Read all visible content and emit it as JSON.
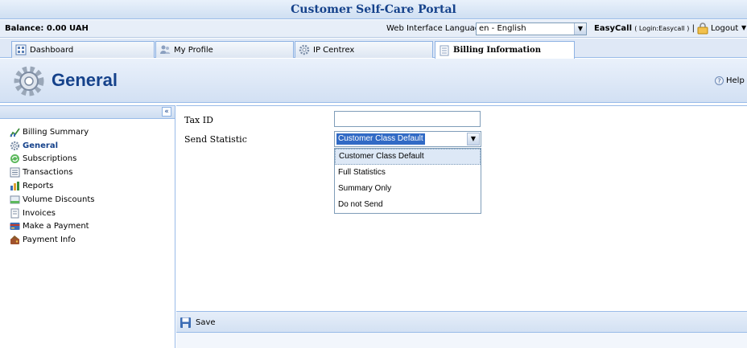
{
  "app": {
    "title": "Customer Self-Care Portal"
  },
  "infobar": {
    "balance": "Balance: 0.00 UAH",
    "language_label": "Web Interface Language:",
    "language_value": "en - English",
    "account_name": "EasyCall",
    "account_login": "( Login:Easycall )",
    "separator": "|",
    "logout": "Logout"
  },
  "tabs": [
    {
      "label": "Dashboard",
      "icon": "dashboard-icon"
    },
    {
      "label": "My Profile",
      "icon": "users-icon"
    },
    {
      "label": "IP Centrex",
      "icon": "gear-icon"
    },
    {
      "label": "Billing Information",
      "icon": "document-icon",
      "active": true
    }
  ],
  "header": {
    "title": "General",
    "help": "Help"
  },
  "sidebar": {
    "collapse": "«",
    "items": [
      {
        "label": "Billing Summary",
        "icon": "chart-icon"
      },
      {
        "label": "General",
        "icon": "gear-icon",
        "active": true
      },
      {
        "label": "Subscriptions",
        "icon": "refresh-icon"
      },
      {
        "label": "Transactions",
        "icon": "list-icon"
      },
      {
        "label": "Reports",
        "icon": "bar-chart-icon"
      },
      {
        "label": "Volume Discounts",
        "icon": "discount-icon"
      },
      {
        "label": "Invoices",
        "icon": "invoice-icon"
      },
      {
        "label": "Make a Payment",
        "icon": "credit-card-icon"
      },
      {
        "label": "Payment Info",
        "icon": "wallet-icon"
      }
    ]
  },
  "form": {
    "tax_id_label": "Tax ID",
    "tax_id_value": "",
    "send_statistic_label": "Send Statistic",
    "send_statistic_value": "Customer Class Default",
    "options": [
      "Customer Class Default",
      "Full Statistics",
      "Summary Only",
      "Do not Send"
    ]
  },
  "footer": {
    "save": "Save"
  },
  "colors": {
    "accent": "#15428b",
    "border": "#99bbe8",
    "selection": "#316ac5"
  }
}
